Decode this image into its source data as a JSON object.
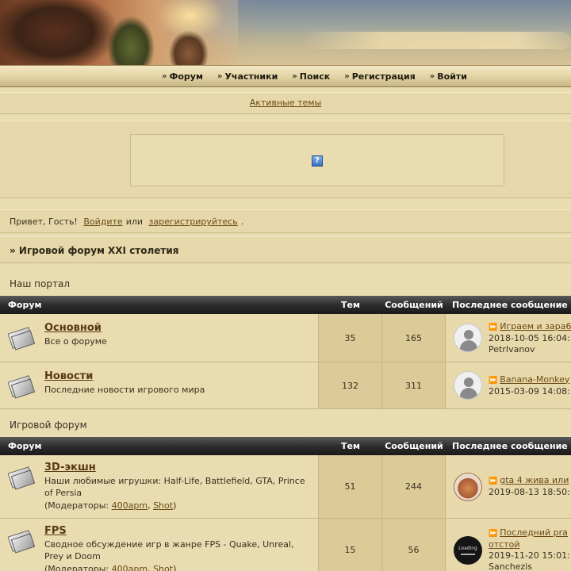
{
  "nav": {
    "items": [
      "Форум",
      "Участники",
      "Поиск",
      "Регистрация",
      "Войти"
    ]
  },
  "active_topics": "Активные темы",
  "greeting": {
    "text": "Привет, Гость!",
    "login": "Войдите",
    "or": "или",
    "register": "зарегистрируйтесь",
    "end": "."
  },
  "crumb": "» Игровой форум XXI столетия",
  "columns": {
    "forum": "Форум",
    "topics": "Тем",
    "posts": "Сообщений",
    "last": "Последнее сообщение"
  },
  "sections": [
    {
      "title": "Наш портал",
      "forums": [
        {
          "name": "Основной",
          "desc": "Все о форуме",
          "topics": "35",
          "posts": "165",
          "last_title": "Играем и зара6",
          "last_date": "2018-10-05 16:04:",
          "last_user": "PetrIvanov"
        },
        {
          "name": "Новости",
          "desc": "Последние новости игрового мира",
          "topics": "132",
          "posts": "311",
          "last_title": "Banana-Monkey",
          "last_date": "2015-03-09 14:08:",
          "last_user": ""
        }
      ]
    },
    {
      "title": "Игровой форум",
      "forums": [
        {
          "name": "3D-экшн",
          "desc": "Наши любимые игрушки: Half-Life, Battlefield, GTA, Prince of Persia",
          "mods_prefix": "(Модераторы:",
          "mod1": "400apm",
          "mod2": "Shot",
          "mods_suffix": ")",
          "topics": "51",
          "posts": "244",
          "last_title": "gta 4 жива или",
          "last_date": "2019-08-13 18:50:",
          "last_user": ""
        },
        {
          "name": "FPS",
          "desc": "Сводное обсуждение игр в жанре FPS - Quake, Unreal, Prey и Doom",
          "mods_prefix": "(Модераторы:",
          "mod1": "400apm",
          "mod2": "Shot",
          "mods_suffix": ")",
          "topics": "15",
          "posts": "56",
          "last_title": "Последний pra",
          "last_title2": "отстой",
          "last_date": "2019-11-20 15:01:",
          "last_user": "Sanchezis",
          "avatar_text": "Loading"
        }
      ]
    }
  ],
  "icons": {
    "ad_placeholder": "?",
    "jump": "⏩",
    "chevron": "»"
  }
}
